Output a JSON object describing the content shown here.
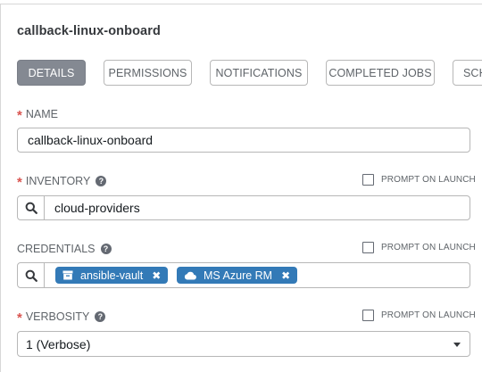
{
  "template": {
    "title": "callback-linux-onboard"
  },
  "tabs": [
    {
      "label": "DETAILS",
      "active": true
    },
    {
      "label": "PERMISSIONS",
      "active": false
    },
    {
      "label": "NOTIFICATIONS",
      "active": false
    },
    {
      "label": "COMPLETED JOBS",
      "active": false
    },
    {
      "label": "SCH",
      "active": false
    }
  ],
  "fields": {
    "name": {
      "label": "NAME",
      "required": true,
      "value": "callback-linux-onboard"
    },
    "inventory": {
      "label": "INVENTORY",
      "required": true,
      "help_icon": "question-circle-icon",
      "prompt_label": "PROMPT ON LAUNCH",
      "prompt_checked": false,
      "value": "cloud-providers"
    },
    "credentials": {
      "label": "CREDENTIALS",
      "required": false,
      "help_icon": "question-circle-icon",
      "prompt_label": "PROMPT ON LAUNCH",
      "prompt_checked": false,
      "chips": [
        {
          "label": "ansible-vault",
          "icon": "archive-icon",
          "remove_icon": "close-icon"
        },
        {
          "label": "MS Azure RM",
          "icon": "cloud-icon",
          "remove_icon": "close-icon"
        }
      ]
    },
    "verbosity": {
      "label": "VERBOSITY",
      "required": true,
      "help_icon": "question-circle-icon",
      "prompt_label": "PROMPT ON LAUNCH",
      "prompt_checked": false,
      "value": "1 (Verbose)"
    }
  },
  "colors": {
    "required": "#d9534f",
    "chip": "#337ab7",
    "active_tab": "#848992"
  }
}
